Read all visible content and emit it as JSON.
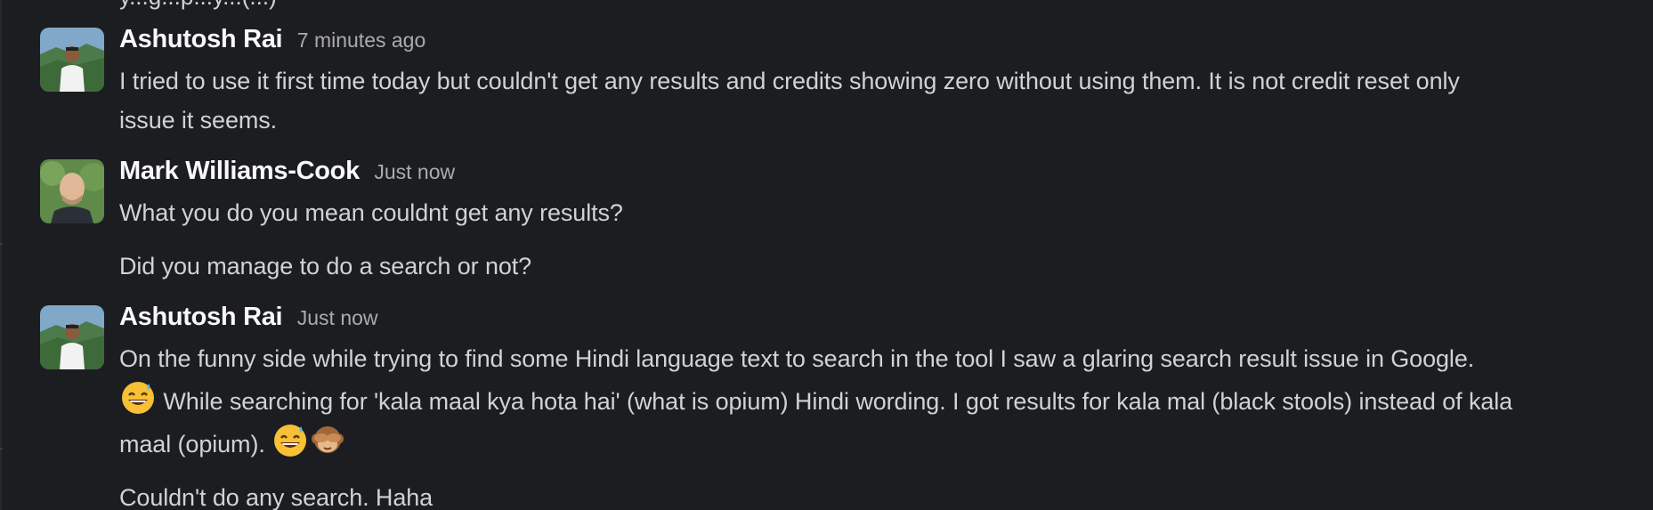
{
  "previous_message_fragment": "y...g...p...y...(...)",
  "messages": [
    {
      "author": "Ashutosh Rai",
      "time": "7 minutes ago",
      "lines": [
        "I tried to use it first time today but couldn't get any results and credits showing zero without using them. It is not credit reset only",
        "issue it seems."
      ]
    },
    {
      "author": "Mark Williams-Cook",
      "time": "Just now",
      "paragraphs": [
        "What you do you mean couldnt get any results?",
        "Did you manage to do a search or not?"
      ]
    },
    {
      "author": "Ashutosh Rai",
      "time": "Just now",
      "line1": "On the funny side while trying to find some Hindi language text to search in the tool I saw a glaring search result issue in Google.",
      "line2": "While searching for 'kala maal kya hota hai' (what is opium) Hindi wording. I got results for kala mal (black stools) instead of kala",
      "line3": "maal (opium).",
      "followup": "Couldn't do any search. Haha"
    }
  ],
  "icons": {
    "emoji_1": "grinning-face-with-sweat-icon",
    "emoji_2": "grinning-face-with-sweat-icon",
    "emoji_3": "see-no-evil-monkey-icon"
  },
  "colors": {
    "background": "#1b1d21",
    "author": "#f8f8f8",
    "timestamp": "#ababad",
    "text": "#d1d2d3"
  }
}
